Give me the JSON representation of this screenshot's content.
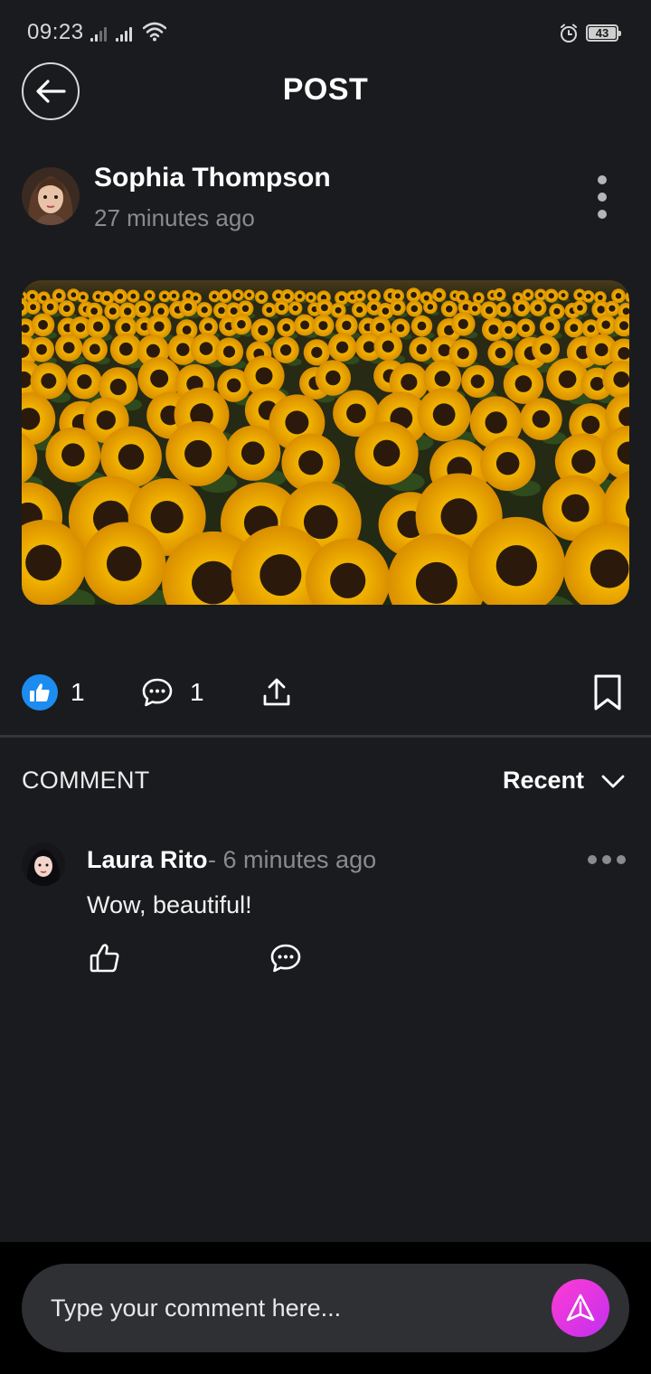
{
  "status_bar": {
    "time": "09:23",
    "battery": "43",
    "icons": [
      "signal-icon",
      "signal-icon",
      "wifi-icon",
      "alarm-icon",
      "battery-icon"
    ]
  },
  "header": {
    "title": "POST",
    "back_icon": "arrow-left-icon"
  },
  "post": {
    "author": "Sophia Thompson",
    "time": "27 minutes ago",
    "image_subject": "sunflower-field",
    "likes": "1",
    "comments": "1",
    "icons": [
      "thumbs-up-icon",
      "comment-icon",
      "share-icon",
      "bookmark-icon",
      "more-vertical-icon"
    ]
  },
  "comments_section": {
    "heading": "COMMENT",
    "sort_label": "Recent",
    "items": [
      {
        "author": "Laura Rito",
        "time": "- 6 minutes ago",
        "text": "Wow, beautiful!"
      }
    ]
  },
  "composer": {
    "placeholder": "Type your comment here...",
    "send_icon": "send-icon"
  },
  "colors": {
    "background": "#1a1b1e",
    "like_blue": "#1d8cf0",
    "send_gradient_start": "#ff3cd4",
    "send_gradient_end": "#c22ff0",
    "muted_text": "#8a8b8f"
  }
}
